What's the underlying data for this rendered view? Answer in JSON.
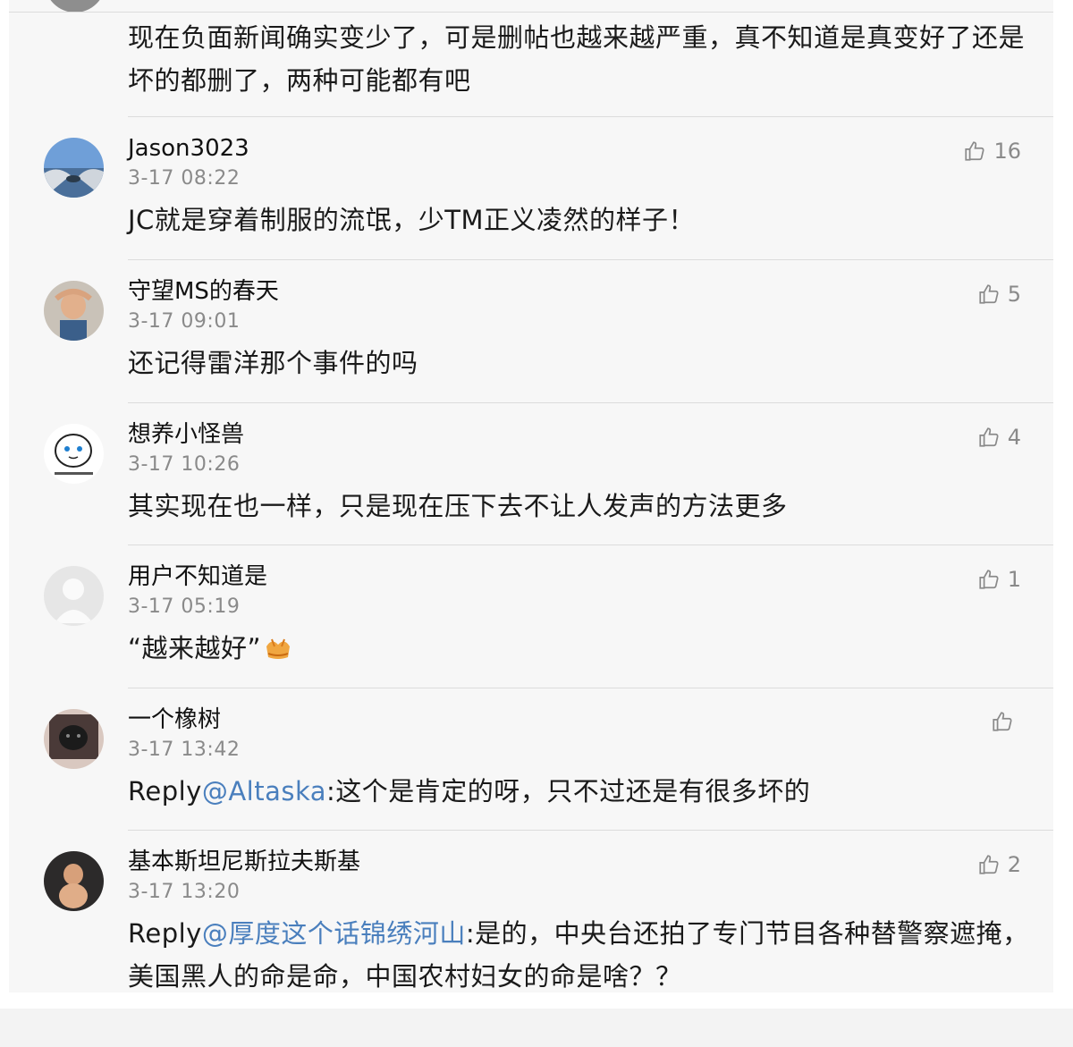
{
  "lead_comment": {
    "text": "现在负面新闻确实变少了，可是删帖也越来越严重，真不知道是真变好了还是坏的都删了，两种可能都有吧"
  },
  "comments": [
    {
      "username": "Jason3023",
      "time": "3-17 08:22",
      "text": "JC就是穿着制服的流氓，少TM正义凌然的样子！",
      "likes": "16",
      "avatar": "sky-avatar"
    },
    {
      "username": "守望MS的春天",
      "time": "3-17 09:01",
      "text": "还记得雷洋那个事件的吗",
      "likes": "5",
      "avatar": "child-avatar"
    },
    {
      "username": "想养小怪兽",
      "time": "3-17 10:26",
      "text": "其实现在也一样，只是现在压下去不让人发声的方法更多",
      "likes": "4",
      "avatar": "cartoon-avatar"
    },
    {
      "username": "用户不知道是",
      "time": "3-17 05:19",
      "text": "“越来越好”",
      "likes": "1",
      "avatar": "default-avatar"
    },
    {
      "username": "一个橡树",
      "time": "3-17 13:42",
      "reply_prefix": "Reply",
      "mention": "@Altaska",
      "text": ":这个是肯定的呀，只不过还是有很多坏的",
      "likes": "",
      "avatar": "dog-avatar"
    },
    {
      "username": "基本斯坦尼斯拉夫斯基",
      "time": "3-17 13:20",
      "reply_prefix": "Reply",
      "mention": "@厚度这个话锦绣河山",
      "text": ":是的，中央台还拍了专门节目各种替警察遮掩，美国黑人的命是命，中国农村妇女的命是啥？？",
      "likes": "2",
      "avatar": "baby-avatar"
    }
  ],
  "icons": {
    "like": "thumbs-up-icon",
    "emoji": "clapping-hands-icon"
  },
  "colors": {
    "mention": "#4a7fbd",
    "meta": "#8a8a8a",
    "background": "#f7f7f7"
  }
}
